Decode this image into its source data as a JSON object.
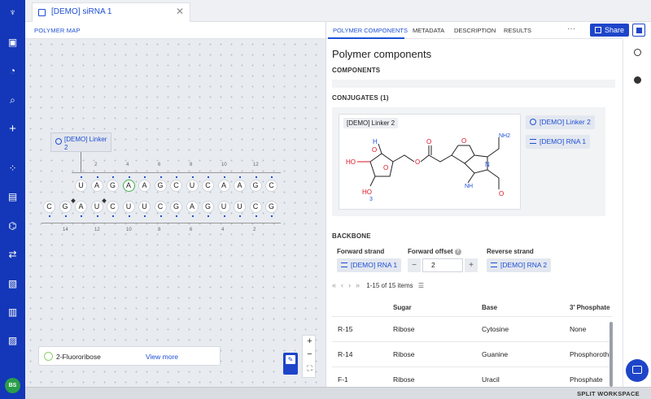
{
  "rail": {
    "icons": [
      "logo-icon",
      "briefcase-icon",
      "dashboard-icon",
      "search-icon",
      "plus-icon",
      "grid-icon",
      "notebook-icon",
      "hierarchy-icon",
      "workflow-icon",
      "clipboard-icon",
      "chart-icon",
      "folder-icon"
    ],
    "avatar": "BS",
    "accent": "#1337b8"
  },
  "document_tab": {
    "label": "[DEMO] siRNA 1",
    "close": "✕"
  },
  "left_pane": {
    "tab": "POLYMER MAP",
    "linker_label": "[DEMO] Linker 2",
    "top_strand": [
      "U",
      "A",
      "G",
      "A",
      "A",
      "G",
      "C",
      "U",
      "C",
      "A",
      "A",
      "G",
      "C"
    ],
    "top_ticks": [
      "2",
      "4",
      "6",
      "8",
      "10",
      "12"
    ],
    "bottom_strand": [
      "C",
      "G",
      "A",
      "U",
      "C",
      "U",
      "U",
      "C",
      "G",
      "A",
      "G",
      "U",
      "U",
      "C",
      "G"
    ],
    "bottom_ticks": [
      "14",
      "12",
      "10",
      "8",
      "6",
      "4",
      "2"
    ],
    "legend_label": "2-Fluororibose",
    "legend_link": "View more",
    "zoom_in": "+",
    "zoom_out": "−",
    "fit": "⛶"
  },
  "right_pane": {
    "tabs": [
      "POLYMER COMPONENTS",
      "METADATA",
      "DESCRIPTION",
      "RESULTS"
    ],
    "more": "···",
    "share": "Share",
    "title": "Polymer components",
    "components_heading": "COMPONENTS",
    "conjugates_heading": "CONJUGATES (1)",
    "conjugate_card_title": "[DEMO] Linker 2",
    "conjugate_chips": [
      "[DEMO] Linker 2",
      "[DEMO] RNA 1"
    ],
    "backbone_heading": "BACKBONE",
    "forward_strand_label": "Forward strand",
    "forward_strand_value": "[DEMO] RNA 1",
    "forward_offset_label": "Forward offset",
    "forward_offset_value": "2",
    "reverse_strand_label": "Reverse strand",
    "reverse_strand_value": "[DEMO] RNA 2",
    "pager_text": "1-15 of 15 items",
    "table": {
      "headers": [
        "",
        "Sugar",
        "Base",
        "3' Phosphate"
      ],
      "rows": [
        [
          "R-15",
          "Ribose",
          "Cytosine",
          "None"
        ],
        [
          "R-14",
          "Ribose",
          "Guanine",
          "Phosphorothioate"
        ],
        [
          "F-1",
          "Ribose",
          "Uracil",
          "Phosphate"
        ]
      ]
    },
    "molecule": {
      "atoms": [
        "H",
        "O",
        "HO",
        "HO",
        "3",
        "O",
        "O",
        "O",
        "NH2",
        "N",
        "NH",
        "O",
        "O"
      ]
    }
  },
  "bottom_bar": {
    "split": "SPLIT WORKSPACE"
  }
}
